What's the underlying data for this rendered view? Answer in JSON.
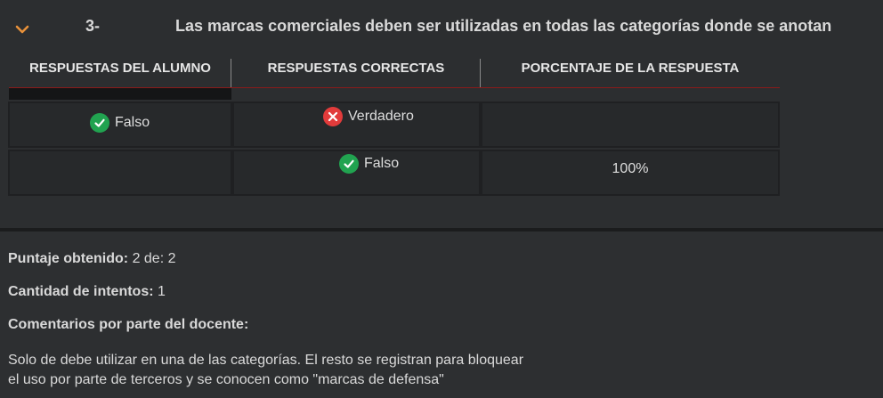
{
  "question": {
    "number": "3-",
    "text": "Las marcas comerciales deben ser utilizadas en todas las categorías donde se anotan"
  },
  "table": {
    "headers": [
      "RESPUESTAS DEL ALUMNO",
      "RESPUESTAS CORRECTAS",
      "PORCENTAJE DE LA RESPUESTA"
    ],
    "rows": [
      {
        "student": "Falso",
        "student_icon": "check-circle-icon",
        "correct": "Verdadero",
        "correct_icon": "x-circle-icon",
        "percent": ""
      },
      {
        "student": "",
        "correct": "Falso",
        "correct_icon": "check-circle-icon",
        "percent": "100%"
      }
    ]
  },
  "result": {
    "score_label": "Puntaje obtenido:",
    "score_value": "2 de: 2",
    "attempts_label": "Cantidad de intentos:",
    "attempts_value": "1",
    "comments_label": "Comentarios por parte del docente:",
    "comment_line1": "Solo de debe utilizar en una de las categorías. El resto se registran para bloquear",
    "comment_line2": "el uso por parte de terceros y se conocen como \"marcas de defensa\""
  },
  "colors": {
    "accent_chevron": "#e8913a",
    "ok": "#21a350",
    "error": "#e23b3b",
    "header_rule": "#8b1a1a"
  }
}
